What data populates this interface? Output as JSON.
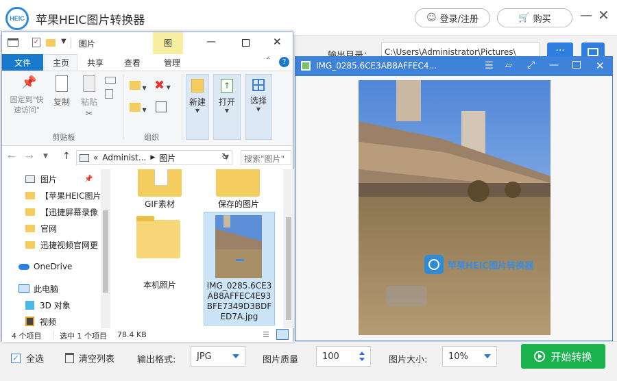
{
  "app": {
    "logo_text": "HEIC",
    "title": "苹果HEIC图片转换器",
    "login_label": "登录/注册",
    "buy_label": "购买",
    "output_dir_label": "输出目录：",
    "output_dir_value": "C:\\Users\\Administrator\\Pictures\\",
    "more_button": "···"
  },
  "bottom": {
    "select_all_label": "全选",
    "clear_list_label": "清空列表",
    "format_label": "输出格式:",
    "format_value": "JPG",
    "quality_label": "图片质量",
    "quality_value": "100",
    "size_label": "图片大小:",
    "size_value": "10%",
    "start_label": "开始转换"
  },
  "viewer": {
    "title": "IMG_0285.6CE3AB8AFFEC4...",
    "watermark": "苹果HEIC图片转换器"
  },
  "explorer": {
    "window_title": "图片",
    "context_tab": "图",
    "tabs": [
      "文件",
      "主页",
      "共享",
      "查看",
      "管理"
    ],
    "ribbon": {
      "pin_label": "固定到\"快速访问\"",
      "copy_label": "复制",
      "paste_label": "粘贴",
      "clipboard_group": "剪贴板",
      "organize_group": "组织",
      "new_label": "新建",
      "open_label": "打开",
      "select_label": "选择"
    },
    "address": {
      "prefix": "«",
      "crumb1": "Administ...",
      "crumb2": "图片",
      "search_placeholder": "搜索\"图片\""
    },
    "nav": [
      "图片",
      "【苹果HEIC图片",
      "【迅捷屏幕录像",
      "官网",
      "迅捷视频官网更",
      "OneDrive",
      "此电脑",
      "3D 对象",
      "视频"
    ],
    "files": {
      "gif": "GIF素材",
      "saved": "保存的图片",
      "camera": "本机照片",
      "img_line1": "IMG_0285.6CE3",
      "img_line2": "AB8AFFEC4E93",
      "img_line3": "BFE7349D3BDF",
      "img_line4": "ED7A.jpg"
    },
    "status": {
      "count": "4 个项目",
      "selected": "选中 1 个项目",
      "size": "78.4 KB"
    }
  },
  "colors": {
    "accent_blue": "#3f82d9",
    "start_green": "#19b24d",
    "folder_yellow": "#f4cd5e"
  }
}
